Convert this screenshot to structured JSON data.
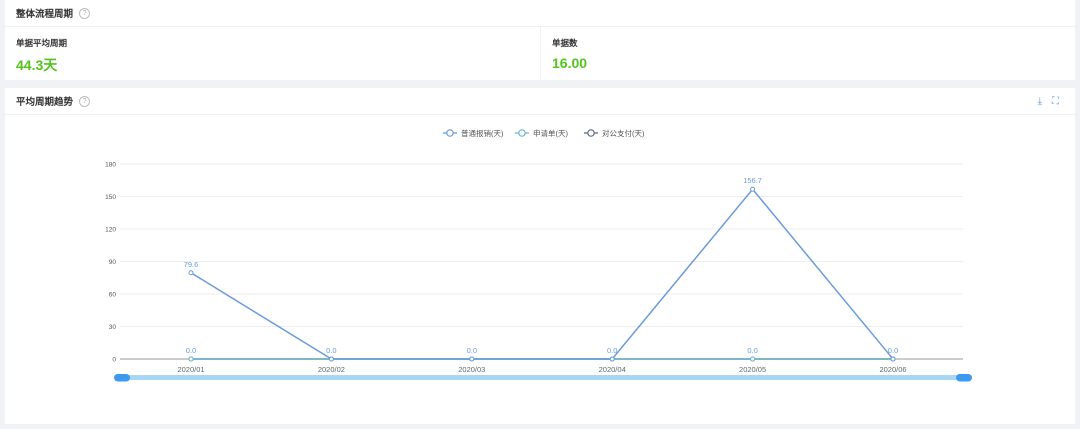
{
  "top_card": {
    "title": "整体流程周期",
    "stats": [
      {
        "label": "单据平均周期",
        "value": "44.3天"
      },
      {
        "label": "单据数",
        "value": "16.00"
      }
    ]
  },
  "chart_card": {
    "title": "平均周期趋势",
    "download_icon": "download-icon",
    "fullscreen_icon": "fullscreen-icon"
  },
  "chart_data": {
    "type": "line",
    "x": [
      "2020/01",
      "2020/02",
      "2020/03",
      "2020/04",
      "2020/05",
      "2020/06"
    ],
    "ylim": [
      0,
      180
    ],
    "yticks": [
      0,
      30,
      60,
      90,
      120,
      150,
      180
    ],
    "grid": true,
    "legend_position": "top-center",
    "series": [
      {
        "name": "普通报销(天)",
        "color": "#6a9bdc",
        "values": [
          79.6,
          0,
          0,
          0,
          156.7,
          0
        ],
        "labels": [
          "79.6",
          "",
          "",
          "",
          "156.7",
          ""
        ]
      },
      {
        "name": "申请单(天)",
        "color": "#6fb8c9",
        "values": [
          0,
          0,
          0,
          0,
          0,
          0
        ],
        "labels": [
          "0.0",
          "0.0",
          "0.0",
          "0.0",
          "0.0",
          "0.0"
        ]
      },
      {
        "name": "对公支付(天)",
        "color": "#5e6b85",
        "values": [
          0,
          0,
          0,
          0,
          0,
          0
        ],
        "labels": [
          "",
          "",
          "",
          "",
          "",
          ""
        ]
      }
    ],
    "zoom_bar": {
      "color": "#a8d6f5",
      "handle_color": "#3d98f0"
    }
  }
}
